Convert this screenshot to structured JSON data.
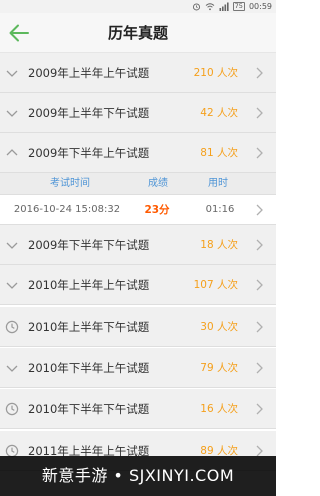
{
  "status_bar": {
    "battery": "75",
    "time": "00:59"
  },
  "header": {
    "title": "历年真题"
  },
  "exam_list": [
    {
      "name": "2009年上半年上午试题",
      "count": "210 人次",
      "icon": "chevron-down-icon"
    },
    {
      "name": "2009年上半年下午试题",
      "count": "42 人次",
      "icon": "chevron-down-icon"
    },
    {
      "name": "2009年下半年上午试题",
      "count": "81 人次",
      "icon": "chevron-up-icon"
    },
    {
      "name": "2009年下半年下午试题",
      "count": "18 人次",
      "icon": "chevron-down-icon"
    },
    {
      "name": "2010年上半年上午试题",
      "count": "107 人次",
      "icon": "chevron-down-icon"
    },
    {
      "name": "2010年上半年下午试题",
      "count": "30 人次",
      "icon": "clock-icon"
    },
    {
      "name": "2010年下半年上午试题",
      "count": "79 人次",
      "icon": "chevron-down-icon"
    },
    {
      "name": "2010年下半年下午试题",
      "count": "16 人次",
      "icon": "clock-icon"
    },
    {
      "name": "2011年上半年上午试题",
      "count": "89 人次",
      "icon": "clock-icon"
    }
  ],
  "detail": {
    "headers": {
      "time": "考试时间",
      "score": "成绩",
      "duration": "用时"
    },
    "record": {
      "time": "2016-10-24 15:08:32",
      "score": "23分",
      "duration": "01:16"
    }
  },
  "watermark": {
    "text": "新意手游 • SJXINYI.COM"
  },
  "colors": {
    "accent_count": "#f5a01c",
    "score": "#ff5a00",
    "detail_header": "#4f95d6",
    "back_arrow": "#5cb85c"
  }
}
